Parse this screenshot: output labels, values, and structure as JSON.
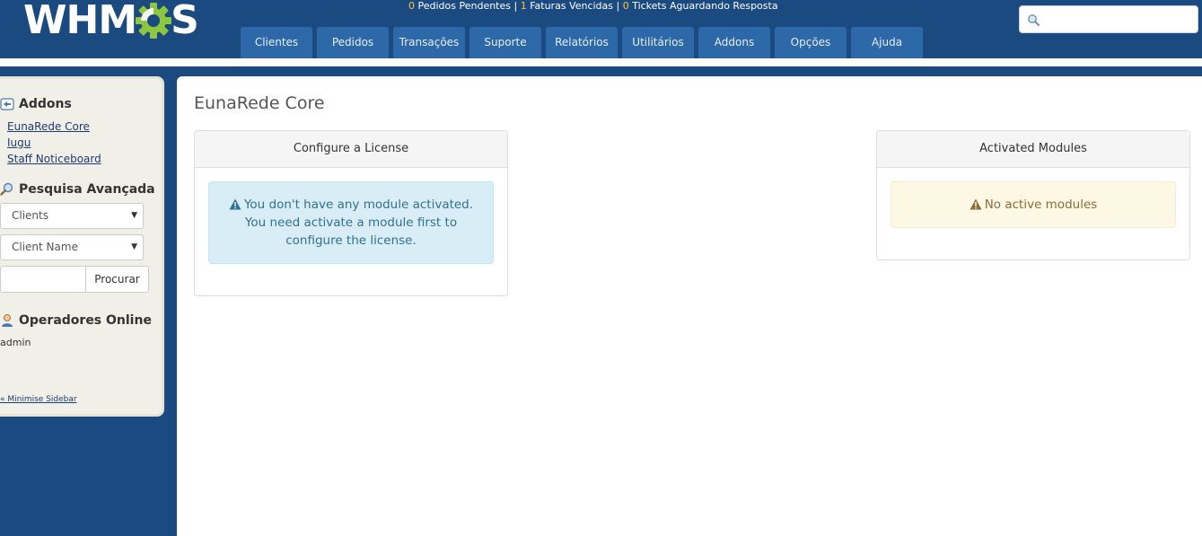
{
  "header": {
    "logo_text_left": "WHM",
    "logo_text_right": "S",
    "stats": {
      "pending_orders_count": "0",
      "pending_orders_label": " Pedidos Pendentes | ",
      "overdue_invoices_count": "1",
      "overdue_invoices_label": " Faturas Vencidas | ",
      "awaiting_tickets_count": "0",
      "awaiting_tickets_label": " Tickets Aguardando Resposta"
    },
    "search": {
      "placeholder": "",
      "icon": "search-icon"
    },
    "accent_color": "#f7c53b",
    "bg_color": "#1a4a80",
    "tab_color": "#2d68a9"
  },
  "nav": {
    "tabs": [
      {
        "label": "Clientes"
      },
      {
        "label": "Pedidos"
      },
      {
        "label": "Transações"
      },
      {
        "label": "Suporte"
      },
      {
        "label": "Relatórios"
      },
      {
        "label": "Utilitários"
      },
      {
        "label": "Addons"
      },
      {
        "label": "Opções"
      },
      {
        "label": "Ajuda"
      }
    ]
  },
  "sidebar": {
    "addons": {
      "heading": "Addons",
      "icon": "addons-icon",
      "links": [
        "EunaRede Core",
        "Iugu",
        "Staff Noticeboard"
      ]
    },
    "advanced_search": {
      "heading": "Pesquisa Avançada",
      "icon": "magnifier-icon",
      "type_select": "Clients",
      "field_select": "Client Name",
      "query_value": "",
      "button_label": "Procurar"
    },
    "online_staff": {
      "heading": "Operadores Online",
      "icon": "user-icon",
      "users": [
        "admin"
      ]
    },
    "minimise_label": "« Minimise Sidebar"
  },
  "main": {
    "title": "EunaRede Core",
    "license_panel": {
      "heading": "Configure a License",
      "alert_line1": "You don't have any module activated.",
      "alert_line2": "You need activate a module first to",
      "alert_line3": "configure the license."
    },
    "modules_panel": {
      "heading": "Activated Modules",
      "alert": "No active modules"
    }
  }
}
